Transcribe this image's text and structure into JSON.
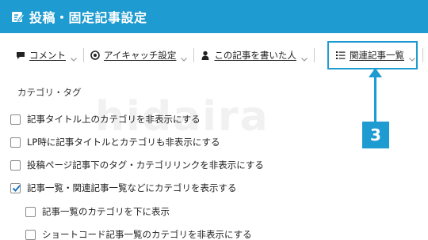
{
  "header": {
    "title": "投稿・固定記事設定",
    "icon": "edit-icon"
  },
  "tabs": [
    {
      "label": "コメント",
      "icon": "comment-icon"
    },
    {
      "label": "アイキャッチ設定",
      "icon": "eye-icon"
    },
    {
      "label": "この記事を書いた人",
      "icon": "user-icon"
    },
    {
      "label": "関連記事一覧",
      "icon": "list-icon"
    }
  ],
  "section": {
    "label": "カテゴリ・タグ"
  },
  "options": [
    {
      "label": "記事タイトル上のカテゴリを非表示にする",
      "checked": false
    },
    {
      "label": "LP時に記事タイトルとカテゴリも非表示にする",
      "checked": false
    },
    {
      "label": "投稿ページ記事下のタグ・カテゴリリンクを非表示にする",
      "checked": false
    },
    {
      "label": "記事一覧・関連記事一覧などにカテゴリを表示する",
      "checked": true
    },
    {
      "label": "記事一覧のカテゴリを下に表示",
      "checked": false
    },
    {
      "label": "ショートコード記事一覧のカテゴリを非表示にする",
      "checked": false
    }
  ],
  "watermark": "hidaira",
  "callout": {
    "number": "3"
  },
  "colors": {
    "accent": "#1e9bd0",
    "checkmark": "#1e73be"
  }
}
